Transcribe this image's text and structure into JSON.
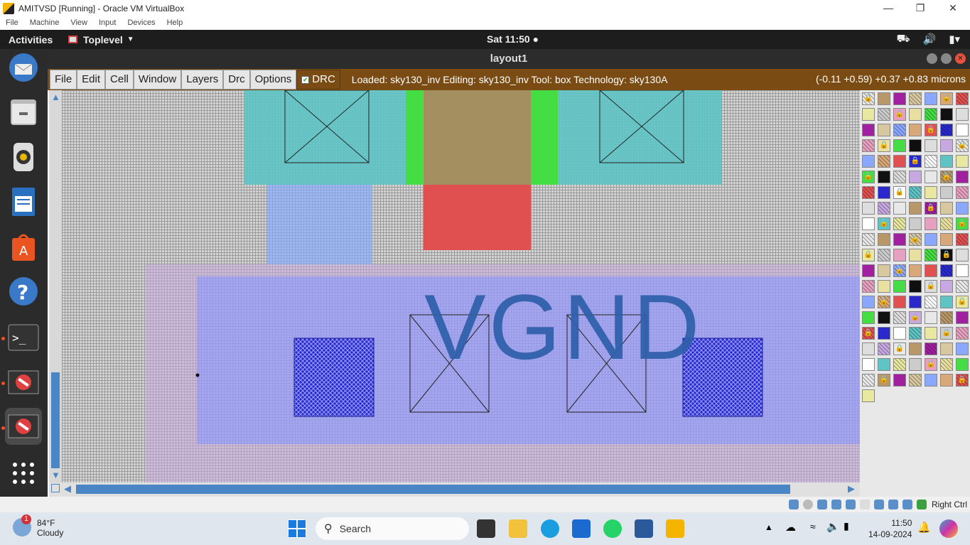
{
  "vbox": {
    "title": "AMITVSD [Running] - Oracle VM VirtualBox",
    "menu": [
      "File",
      "Machine",
      "View",
      "Input",
      "Devices",
      "Help"
    ],
    "status_right": "Right Ctrl"
  },
  "gnome": {
    "activities": "Activities",
    "app_menu": "Toplevel",
    "clock": "Sat 11:50 ●"
  },
  "magic": {
    "window_title": "layout1",
    "menu": [
      "File",
      "Edit",
      "Cell",
      "Window",
      "Layers",
      "Drc",
      "Options"
    ],
    "drc_label": "DRC",
    "drc_checked": true,
    "status": "Loaded: sky130_inv Editing: sky130_inv Tool: box  Technology: sky130A",
    "coords": "(-0.11 +0.59) +0.37 +0.83 microns",
    "net_label": "VGND"
  },
  "taskbar": {
    "weather_temp": "84°F",
    "weather_desc": "Cloudy",
    "weather_badge": "1",
    "search_placeholder": "Search",
    "time": "11:50",
    "date": "14-09-2024"
  },
  "colors": {
    "toolbar_bg": "#7a4c14",
    "diff_cyan": "#5ec4c4",
    "poly_red": "#e05050",
    "locali_blue": "#8aa8ff",
    "metal_purple": "#c8a8e0",
    "nwell_green": "#44dd44",
    "contact_blue": "#2a2acc",
    "label_blue": "#2e5faa"
  }
}
